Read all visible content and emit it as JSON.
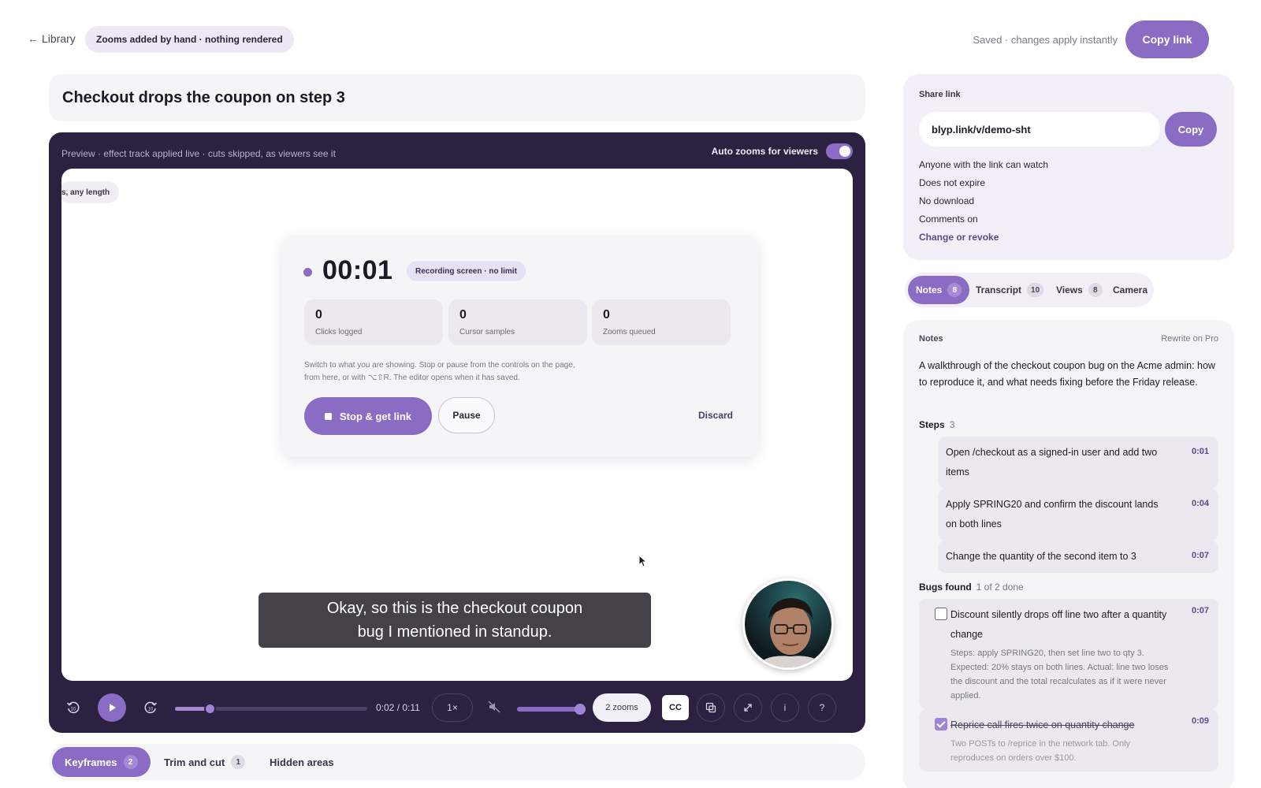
{
  "topbar": {
    "back_label": "Library",
    "chip": "Zooms added by hand · nothing rendered",
    "saved": "Saved · changes apply instantly",
    "copy_link": "Copy link"
  },
  "title": "Checkout drops the coupon on step 3",
  "player": {
    "preview_text": "Preview · effect track applied live · cuts skipped, as viewers see it",
    "auto_zoom_label": "Auto zooms for viewers",
    "auto_zoom_on": true,
    "cutoff_chip": "s, any length",
    "recorder": {
      "time": "00:01",
      "badge": "Recording screen · no limit",
      "stats": [
        {
          "value": "0",
          "label": "Clicks logged"
        },
        {
          "value": "0",
          "label": "Cursor samples"
        },
        {
          "value": "0",
          "label": "Zooms queued"
        }
      ],
      "help": "Switch to what you are showing. Stop or pause from the controls on the page, from here, or with ⌥⇧R. The editor opens when it has saved.",
      "stop_label": "Stop & get link",
      "pause_label": "Pause",
      "discard_label": "Discard"
    },
    "caption": "Okay, so this is the checkout coupon bug I mentioned in standup.",
    "controls": {
      "time": "0:02 / 0:11",
      "progress_fraction": 0.18,
      "speed": "1×",
      "volume_fraction": 1.0,
      "zooms": "2 zooms",
      "cc": "CC",
      "info": "i",
      "help": "?"
    }
  },
  "bottom_tabs": [
    {
      "label": "Keyframes",
      "count": "2",
      "active": true
    },
    {
      "label": "Trim and cut",
      "count": "1",
      "active": false
    },
    {
      "label": "Hidden areas",
      "count": "",
      "active": false
    }
  ],
  "share": {
    "label": "Share link",
    "url": "blyp.link/v/demo-sht",
    "copy": "Copy",
    "lines": [
      "Anyone with the link can watch",
      "Does not expire",
      "No download",
      "Comments on"
    ],
    "change": "Change or revoke"
  },
  "right_tabs": [
    {
      "label": "Notes",
      "count": "8",
      "active": true
    },
    {
      "label": "Transcript",
      "count": "10",
      "active": false
    },
    {
      "label": "Views",
      "count": "8",
      "active": false
    },
    {
      "label": "Camera",
      "count": "",
      "active": false
    }
  ],
  "notes": {
    "head": "Notes",
    "rewrite": "Rewrite on Pro",
    "summary": "A walkthrough of the checkout coupon bug on the Acme admin: how to reproduce it, and what needs fixing before the Friday release.",
    "steps_label": "Steps",
    "steps_count": "3",
    "steps": [
      {
        "text": "Open /checkout as a signed-in user and add two items",
        "time": "0:01"
      },
      {
        "text": "Apply SPRING20 and confirm the discount lands on both lines",
        "time": "0:04"
      },
      {
        "text": "Change the quantity of the second item to 3",
        "time": "0:07"
      }
    ],
    "bugs_label": "Bugs found",
    "bugs_count": "1 of 2 done",
    "bugs": [
      {
        "title": "Discount silently drops off line two after a quantity change",
        "time": "0:07",
        "done": false,
        "desc": "Steps: apply SPRING20, then set line two to qty 3. Expected: 20% stays on both lines. Actual: line two loses the discount and the total recalculates as if it were never applied."
      },
      {
        "title": "Reprice call fires twice on quantity change",
        "time": "0:09",
        "done": true,
        "desc": "Two POSTs to /reprice in the network tab. Only reproduces on orders over $100."
      }
    ]
  },
  "colors": {
    "accent": "#8b6cc4",
    "player_bg": "#2c2140",
    "card_bg": "#f5f4f6"
  }
}
